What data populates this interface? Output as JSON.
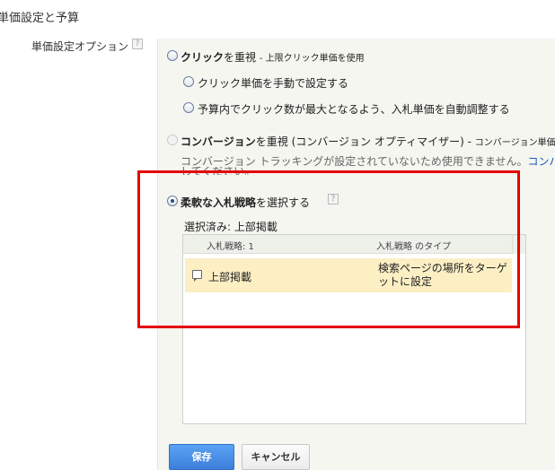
{
  "section": {
    "title": "単価設定と予算"
  },
  "bid_option": {
    "label": "単価設定オプション",
    "help": "?"
  },
  "options": {
    "click": {
      "title": "クリック",
      "title_suffix": "を重視",
      "note": "- 上限クリック単価を使用",
      "sub_manual": "クリック単価を手動で設定する",
      "sub_auto": "予算内でクリック数が最大となるよう、入札単価を自動調整する"
    },
    "conversion": {
      "title": "コンバージョン",
      "title_suffix": "を重視 (コンバージョン オプティマイザー) -",
      "note": "コンバージョン単価を使",
      "unavailable": "コンバージョン トラッキングが設定されていないため使用できません。",
      "link": "コンバージ",
      "line2": "してください。"
    },
    "flexible": {
      "title": "柔軟な入札戦略",
      "title_suffix": "を選択する",
      "help": "?",
      "selected": "選択済み: 上部掲載"
    }
  },
  "strategy_table": {
    "col_strategy": "入札戦略: 1",
    "col_type": "入札戦略 のタイプ",
    "rows": [
      {
        "name": "上部掲載",
        "type": "検索ページの場所をターゲットに設定"
      }
    ]
  },
  "buttons": {
    "save": "保存",
    "cancel": "キャンセル"
  },
  "colors": {
    "highlight_box": "#e60000",
    "selected_row": "#fcefc4",
    "save_button": "#4a8fe7",
    "link": "#1a57c4"
  }
}
